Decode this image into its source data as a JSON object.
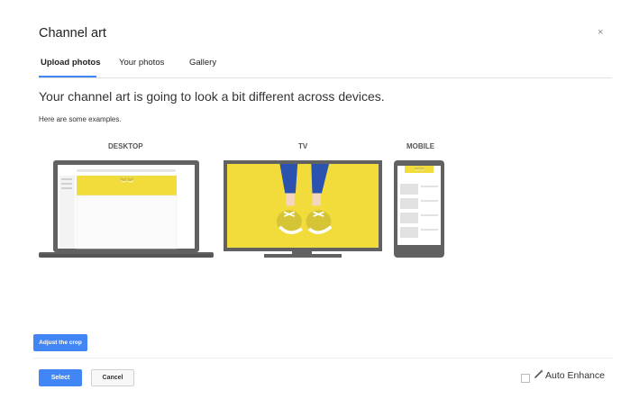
{
  "dialog": {
    "title": "Channel art",
    "close_glyph": "×"
  },
  "tabs": [
    {
      "label": "Upload photos",
      "active": true
    },
    {
      "label": "Your photos",
      "active": false
    },
    {
      "label": "Gallery",
      "active": false
    }
  ],
  "content": {
    "headline": "Your channel art is going to look a bit different across devices.",
    "subtext": "Here are some examples.",
    "devices": [
      {
        "label": "DESKTOP"
      },
      {
        "label": "TV"
      },
      {
        "label": "MOBILE"
      }
    ]
  },
  "buttons": {
    "adjust_crop": "Adjust the crop",
    "select": "Select",
    "cancel": "Cancel"
  },
  "auto_enhance": {
    "label": "Auto Enhance",
    "checked": false,
    "icon": "magic-wand-icon"
  },
  "colors": {
    "accent": "#4285f4",
    "art_yellow": "#f2dc3c",
    "device_frame": "#616161",
    "jeans": "#2c52b0"
  }
}
